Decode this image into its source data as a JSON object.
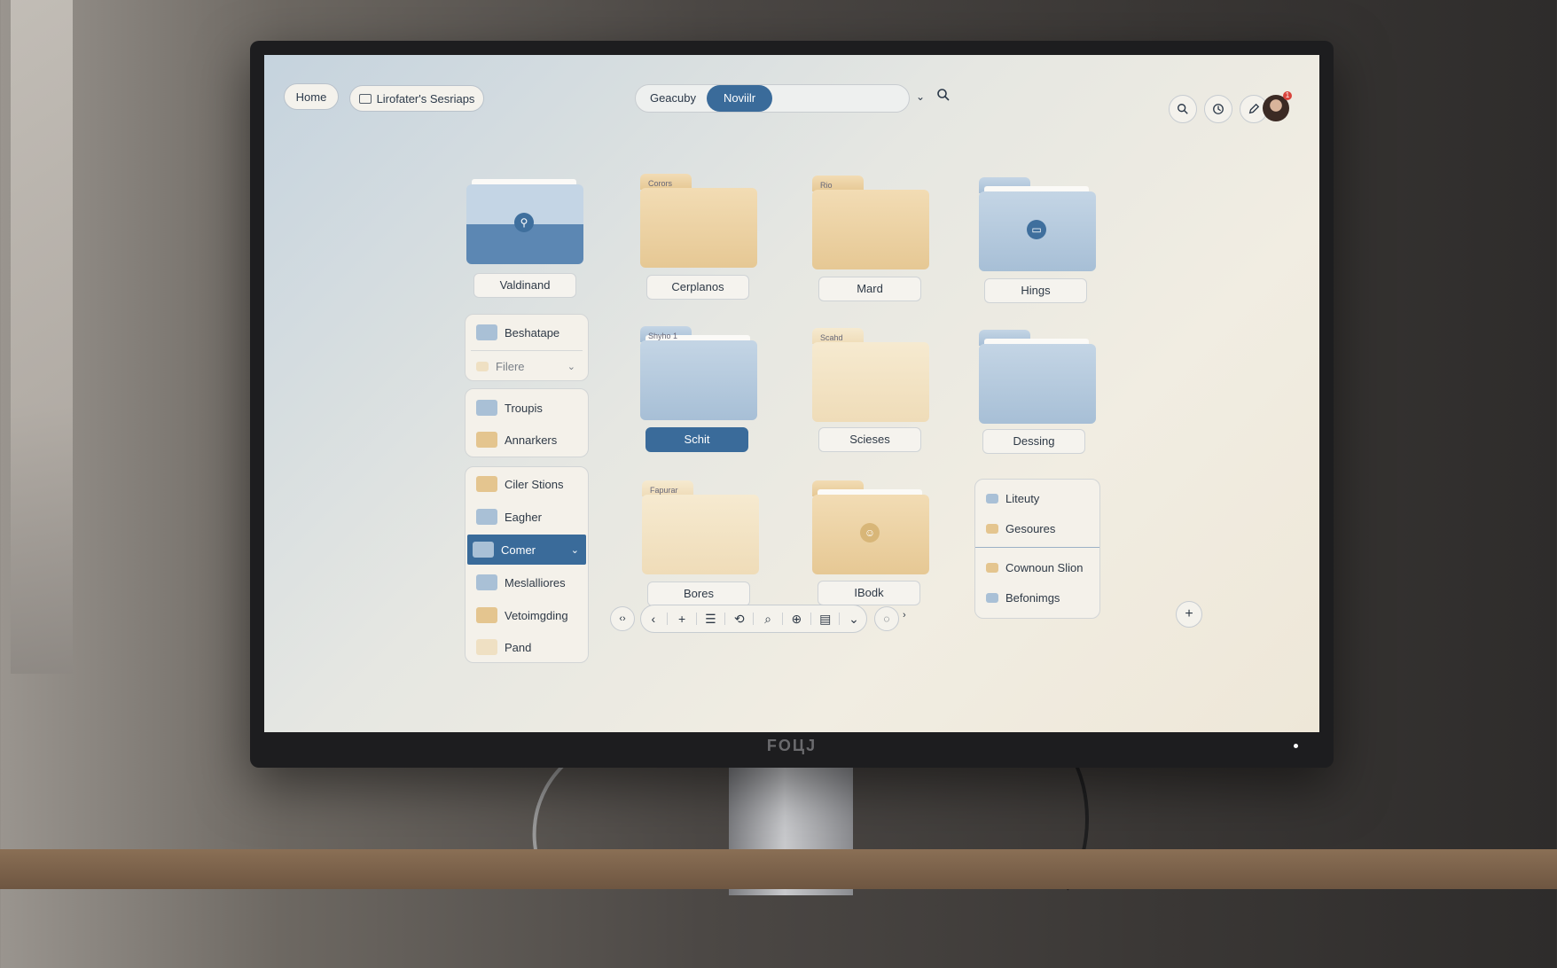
{
  "monitor": {
    "brand": "FOЦJ"
  },
  "topbar": {
    "home_label": "Home",
    "breadcrumb_label": "Lirofater's Sesriaps",
    "segment_left": "Geacuby",
    "segment_active": "Noviilr",
    "notification_count": "1"
  },
  "folders": [
    {
      "label": "Valdinand",
      "tag": "",
      "color": "split",
      "emblem": "pin"
    },
    {
      "label": "Cerplanos",
      "tag": "Corors",
      "color": "tan"
    },
    {
      "label": "Mard",
      "tag": "Rio",
      "color": "tan"
    },
    {
      "label": "Hings",
      "tag": "",
      "color": "blue",
      "emblem": "badge"
    },
    {
      "label": "Schit",
      "tag": "Shyho 1",
      "color": "blue",
      "selected": true
    },
    {
      "label": "Scieses",
      "tag": "Scahd",
      "color": "cream"
    },
    {
      "label": "Dessing",
      "tag": "",
      "color": "blue"
    },
    {
      "label": "Bores",
      "tag": "Fapurar",
      "color": "cream"
    },
    {
      "label": "IBodk",
      "tag": "",
      "color": "tan",
      "emblem": "face"
    }
  ],
  "sidebar": {
    "group1": [
      {
        "label": "Beshatape",
        "color": "blue"
      },
      {
        "label": "Filere",
        "color": "cream",
        "muted": true
      }
    ],
    "group2": [
      {
        "label": "Troupis",
        "color": "blue"
      },
      {
        "label": "Annarkers",
        "color": "tan"
      }
    ],
    "group3": [
      {
        "label": "Ciler Stions",
        "color": "tan"
      },
      {
        "label": "Eagher",
        "color": "blue"
      },
      {
        "label": "Comer",
        "color": "blue",
        "selected": true
      },
      {
        "label": "Meslalliores",
        "color": "blue"
      },
      {
        "label": "Vetoimgding",
        "color": "tan"
      },
      {
        "label": "Pand",
        "color": "cream"
      }
    ]
  },
  "right_panel": {
    "top": [
      {
        "label": "Liteuty",
        "color": "blue"
      },
      {
        "label": "Gesoures",
        "color": "tan"
      }
    ],
    "bottom": [
      {
        "label": "Cownoun Slion",
        "color": "tan"
      },
      {
        "label": "Befonimgs",
        "color": "blue"
      }
    ]
  }
}
